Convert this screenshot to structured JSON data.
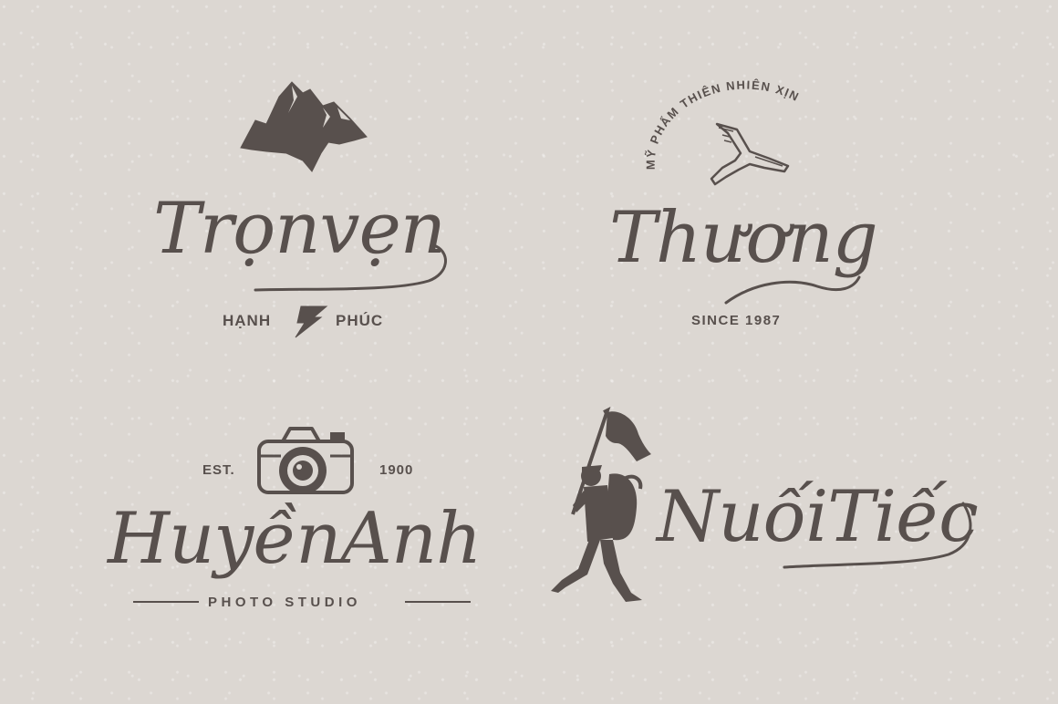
{
  "logos": [
    {
      "wordmark": "Trọnvẹn",
      "tagline_left": "HẠNH",
      "tagline_right": "PHÚC",
      "icon": "mountain-icon",
      "divider_icon": "lightning-icon"
    },
    {
      "arc_text": "MỸ PHẨM THIÊN NHIÊN XỊN",
      "wordmark": "Thương",
      "tagline": "SINCE 1987",
      "icon": "straight-razor-icon"
    },
    {
      "est_label": "EST.",
      "year": "1900",
      "wordmark": "HuyềnAnh",
      "tagline": "PHOTO STUDIO",
      "icon": "camera-icon"
    },
    {
      "wordmark": "NuốiTiếc",
      "icon": "hiker-icon"
    }
  ],
  "colors": {
    "background": "#dcd7d2",
    "ink": "#58504d"
  }
}
